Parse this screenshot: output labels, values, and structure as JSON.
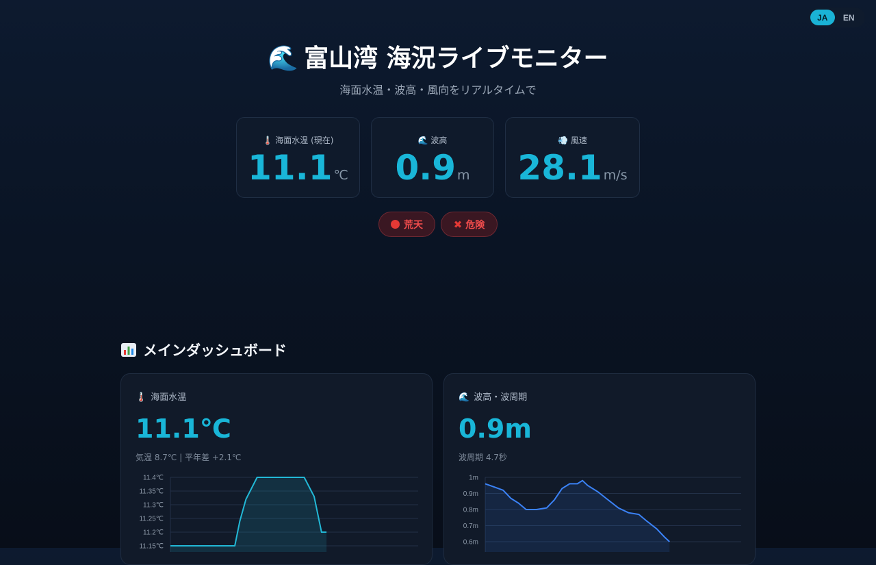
{
  "lang": {
    "ja": "JA",
    "en": "EN"
  },
  "header": {
    "icon": "🌊",
    "title": "富山湾 海況ライブモニター",
    "subtitle": "海面水温・波高・風向をリアルタイムで"
  },
  "stats": [
    {
      "icon": "🌡️",
      "label": "海面水温 (現在)",
      "value": "11.1",
      "unit": "℃"
    },
    {
      "icon": "🌊",
      "label": "波高",
      "value": "0.9",
      "unit": "m"
    },
    {
      "icon": "💨",
      "label": "風速",
      "value": "28.1",
      "unit": "m/s"
    }
  ],
  "badges": {
    "weather": "荒天",
    "danger": "危険"
  },
  "section": {
    "icon": "bar-chart-icon",
    "title": "メインダッシュボード"
  },
  "cards": {
    "sst": {
      "icon": "🌡️",
      "label": "海面水温",
      "value": "11.1℃",
      "sub": "気温 8.7℃ | 平年差 +2.1℃"
    },
    "wave": {
      "icon": "🌊",
      "label": "波高・波周期",
      "value": "0.9m",
      "sub": "波周期 4.7秒"
    }
  },
  "colors": {
    "accent": "#19b6d8",
    "danger": "#f04c4c",
    "wave_line": "#3b82f6"
  },
  "chart_data": [
    {
      "type": "area",
      "y_ticks": [
        "11.4℃",
        "11.35℃",
        "11.3℃",
        "11.25℃",
        "11.2℃",
        "11.15℃"
      ],
      "y_tick_values": [
        11.4,
        11.35,
        11.3,
        11.25,
        11.2,
        11.15
      ],
      "ylim": [
        11.15,
        11.4
      ],
      "x": [
        0,
        0.26,
        0.28,
        0.305,
        0.35,
        0.42,
        0.48,
        0.54,
        0.58,
        0.61,
        0.63
      ],
      "values": [
        11.15,
        11.15,
        11.24,
        11.32,
        11.4,
        11.4,
        11.4,
        11.4,
        11.33,
        11.2,
        11.2
      ],
      "xlim": [
        0,
        1
      ],
      "grid": true
    },
    {
      "type": "area",
      "y_ticks": [
        "1m",
        "0.9m",
        "0.8m",
        "0.7m",
        "0.6m"
      ],
      "y_tick_values": [
        1.0,
        0.9,
        0.8,
        0.7,
        0.6
      ],
      "ylim": [
        0.6,
        1.0
      ],
      "x": [
        0,
        0.035,
        0.07,
        0.1,
        0.13,
        0.16,
        0.2,
        0.24,
        0.27,
        0.3,
        0.33,
        0.36,
        0.38,
        0.4,
        0.44,
        0.48,
        0.52,
        0.56,
        0.6,
        0.63,
        0.67,
        0.7,
        0.72
      ],
      "values": [
        0.96,
        0.94,
        0.92,
        0.87,
        0.84,
        0.8,
        0.8,
        0.81,
        0.86,
        0.93,
        0.96,
        0.96,
        0.98,
        0.95,
        0.91,
        0.86,
        0.81,
        0.78,
        0.77,
        0.73,
        0.68,
        0.63,
        0.6
      ],
      "xlim": [
        0,
        1
      ],
      "grid": true
    }
  ]
}
